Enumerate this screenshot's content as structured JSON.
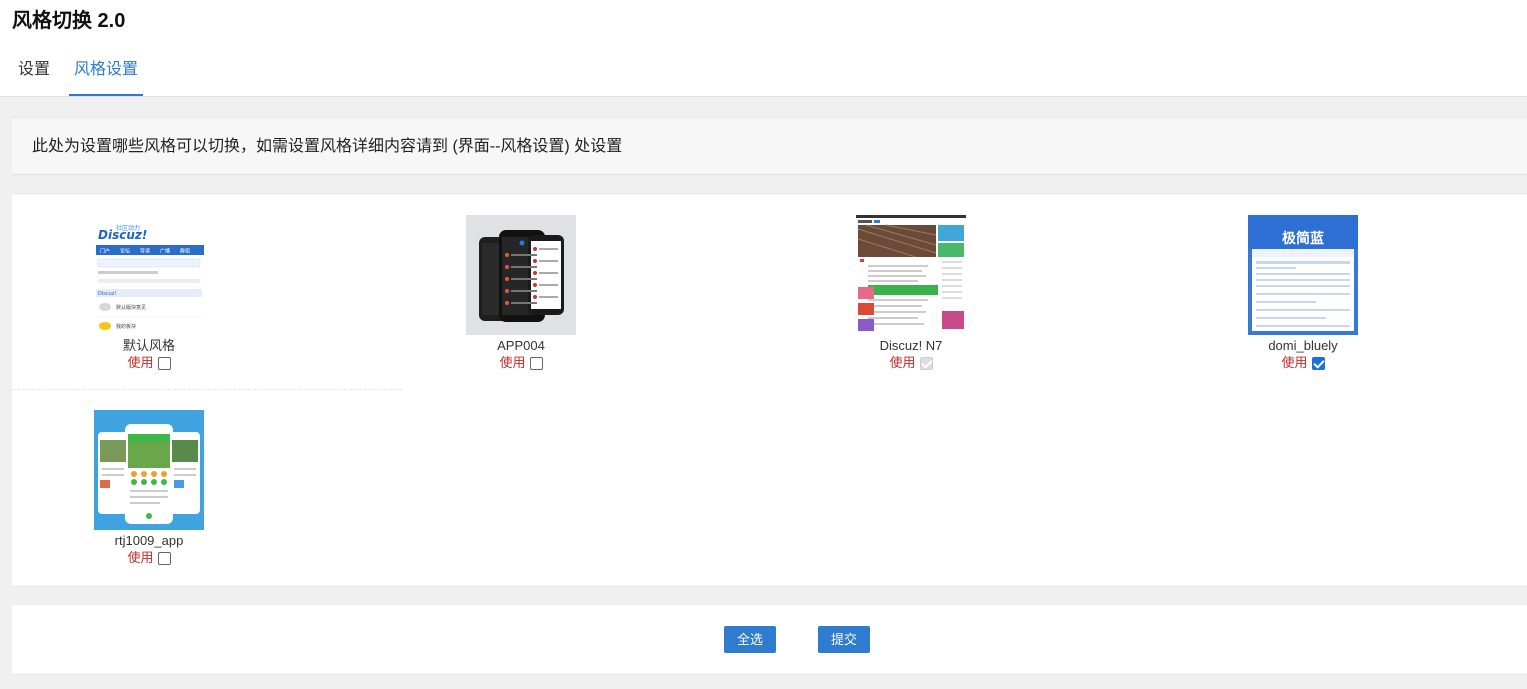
{
  "header": {
    "title": "风格切换 2.0",
    "tabs": [
      {
        "label": "设置",
        "active": false
      },
      {
        "label": "风格设置",
        "active": true
      }
    ]
  },
  "notice": {
    "text": "此处为设置哪些风格可以切换，如需设置风格详细内容请到 (界面--风格设置) 处设置"
  },
  "styles": [
    {
      "name": "默认风格",
      "use_label": "使用",
      "checked": false,
      "disabled": false
    },
    {
      "name": "APP004",
      "use_label": "使用",
      "checked": false,
      "disabled": false
    },
    {
      "name": "Discuz! N7",
      "use_label": "使用",
      "checked": true,
      "disabled": true
    },
    {
      "name": "domi_bluely",
      "use_label": "使用",
      "checked": true,
      "disabled": false
    },
    {
      "name": "rtj1009_app",
      "use_label": "使用",
      "checked": false,
      "disabled": false
    }
  ],
  "thumbnails": {
    "discuz_logo_text": "Discuz!",
    "discuz_slogan": "社区动力",
    "discuz_nav": [
      "门户",
      "论坛",
      "导读",
      "广播",
      "群组"
    ],
    "discuz_section": "Discuz!",
    "discuz_forum1": "默认版块意见",
    "discuz_forum2": "我的板块",
    "domi_banner": "极简蓝"
  },
  "actions": {
    "select_all": "全选",
    "submit": "提交"
  },
  "colors": {
    "accent": "#2a7bd1",
    "button": "#2e7bcf",
    "use_label": "#c82a2a"
  }
}
